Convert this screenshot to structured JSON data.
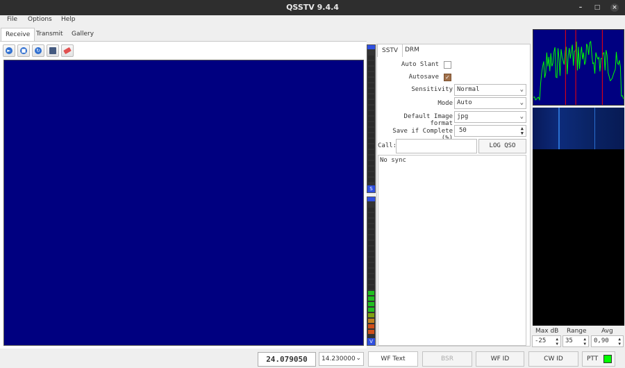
{
  "window": {
    "title": "QSSTV 9.4.4"
  },
  "menu": [
    "File",
    "Options",
    "Help"
  ],
  "tabs": [
    "Receive",
    "Transmit",
    "Gallery"
  ],
  "meters": {
    "s_label": "S",
    "v_label": "V",
    "volume_level": 0.33
  },
  "settings": {
    "tabs": [
      "SSTV",
      "DRM"
    ],
    "auto_slant_label": "Auto Slant",
    "auto_slant_checked": false,
    "autosave_label": "Autosave",
    "autosave_checked": true,
    "sensitivity_label": "Sensitivity",
    "sensitivity_value": "Normal",
    "mode_label": "Mode",
    "mode_value": "Auto",
    "image_format_label": "Default Image format",
    "image_format_value": "jpg",
    "save_complete_label": "Save if Complete (%)",
    "save_complete_value": "50",
    "call_label": "Call:",
    "call_value": "",
    "log_qso_label": "LOG QSO",
    "sync_status": "No sync"
  },
  "analyzer": {
    "max_db_label": "Max dB",
    "range_label": "Range",
    "avg_label": "Avg",
    "max_db_value": "-25",
    "range_value": "35",
    "avg_value": "0,90"
  },
  "statusbar": {
    "frequency_display": "24.079050",
    "frequency_combo": "14.230000",
    "wf_text_label": "WF Text",
    "bsr_label": "BSR",
    "wf_id_label": "WF ID",
    "cw_id_label": "CW ID",
    "ptt_label": "PTT"
  },
  "colors": {
    "image_bg": "#000080",
    "ptt_indicator": "#00ff00",
    "spectrum_line": "#00ff00",
    "marker": "#ff0000"
  }
}
